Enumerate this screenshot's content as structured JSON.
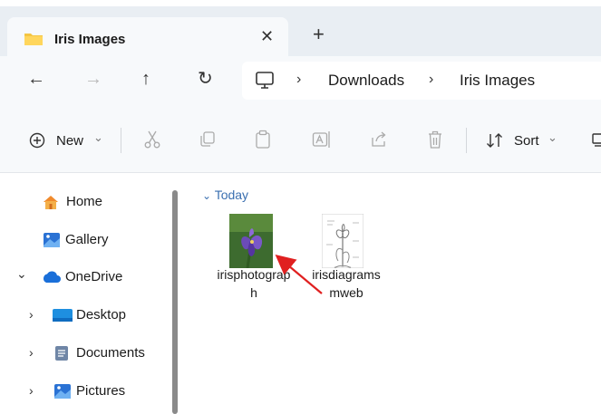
{
  "tab": {
    "title": "Iris Images",
    "close": "✕",
    "new_tab": "+"
  },
  "nav": {
    "back": "←",
    "forward": "→",
    "up": "↑",
    "refresh": "↻"
  },
  "address": {
    "separator": "›",
    "crumbs": [
      "Downloads",
      "Iris Images"
    ]
  },
  "toolbar": {
    "new_label": "New",
    "new_chevron": "⌄",
    "sort_label": "Sort",
    "sort_chevron": "⌄"
  },
  "sidebar": {
    "items": [
      {
        "label": "Home"
      },
      {
        "label": "Gallery"
      },
      {
        "label": "OneDrive",
        "chevron": "⌄"
      },
      {
        "label": "Desktop",
        "chevron": "›"
      },
      {
        "label": "Documents",
        "chevron": "›"
      },
      {
        "label": "Pictures",
        "chevron": "›"
      }
    ]
  },
  "content": {
    "group_label": "Today",
    "group_chevron": "⌄",
    "files": [
      {
        "name": "irisphotograph"
      },
      {
        "name": "irisdiagramsmweb"
      }
    ]
  },
  "colors": {
    "accent": "#3a6fb0",
    "titlebar": "#e9eef3",
    "toolbar": "#f7f9fb",
    "annotation": "#e02020"
  }
}
